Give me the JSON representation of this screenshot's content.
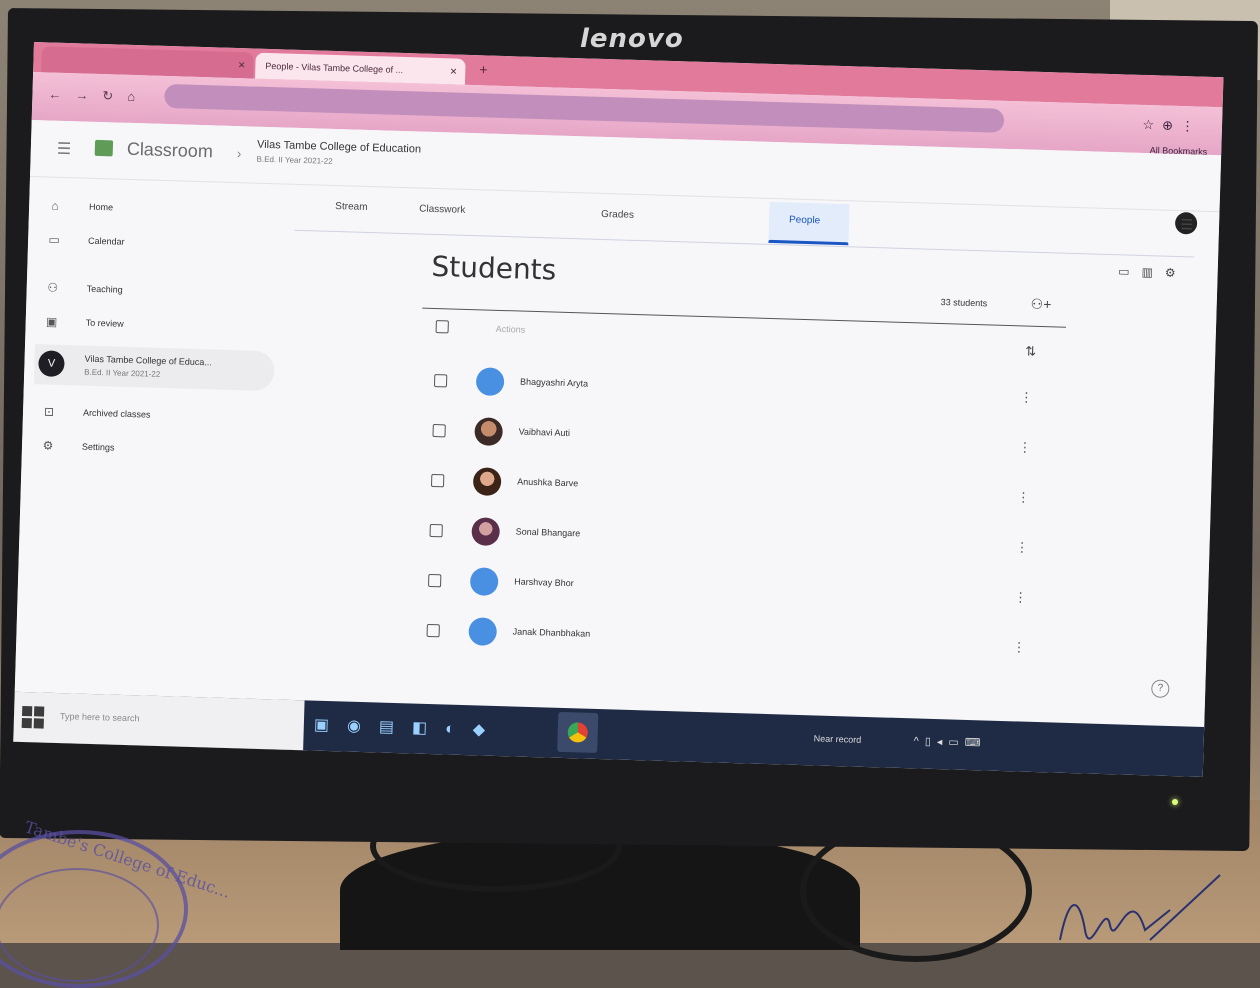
{
  "monitor": {
    "brand": "lenovo"
  },
  "browser": {
    "tabs": [
      {
        "label": "",
        "active": false
      },
      {
        "label": "People - Vilas Tambe College of ...",
        "active": true
      }
    ],
    "url": "",
    "bookmarks_label": "All Bookmarks"
  },
  "classroom": {
    "app_name": "Classroom",
    "class_name": "Vilas Tambe College of Education",
    "class_section": "B.Ed. II Year 2021-22",
    "sidebar": [
      {
        "icon": "home-icon",
        "label": "Home"
      },
      {
        "icon": "calendar-icon",
        "label": "Calendar"
      },
      {
        "icon": "teaching-icon",
        "label": "Teaching"
      },
      {
        "icon": "to-review-icon",
        "label": "To review"
      },
      {
        "icon": "archive-icon",
        "label": "Archived classes"
      },
      {
        "icon": "settings-icon",
        "label": "Settings"
      }
    ],
    "sidebar_class": {
      "initial": "V",
      "name": "Vilas Tambe College of Educa...",
      "section": "B.Ed. II Year 2021-22"
    },
    "tabs": [
      "Stream",
      "Classwork",
      "People",
      "Grades"
    ],
    "active_tab": "People",
    "students_title": "Students",
    "students_count": "33 students",
    "actions_label": "Actions",
    "students": [
      {
        "name": "Bhagyashri Aryta",
        "avatar": "default"
      },
      {
        "name": "Vaibhavi Auti",
        "avatar": "photo"
      },
      {
        "name": "Anushka Barve",
        "avatar": "photo"
      },
      {
        "name": "Sonal Bhangare",
        "avatar": "photo"
      },
      {
        "name": "Harshvay Bhor",
        "avatar": "default"
      },
      {
        "name": "Janak Dhanbhakan",
        "avatar": "default"
      }
    ]
  },
  "taskbar": {
    "search_placeholder": "Type here to search",
    "weather": "Near record"
  },
  "stamp": {
    "text": "Tambe's College of Educ..."
  },
  "colors": {
    "accent": "#1a56c4",
    "tabbar": "#e27a9c",
    "taskbar": "#1f2b45"
  }
}
